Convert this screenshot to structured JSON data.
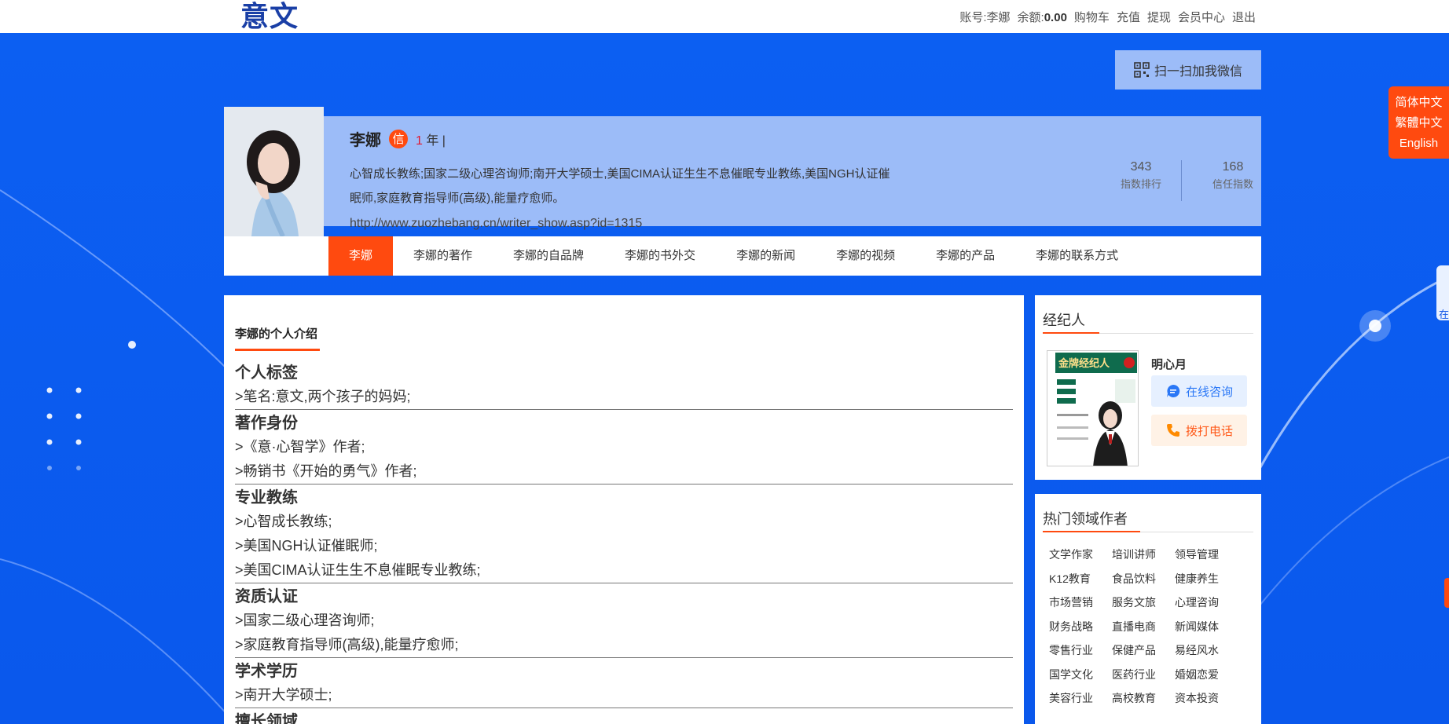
{
  "header": {
    "logo": "意文",
    "account_label": "账号:",
    "account_name": "李娜",
    "balance_label": "余额:",
    "balance_value": "0.00",
    "links": [
      "购物车",
      "充值",
      "提现",
      "会员中心",
      "退出"
    ]
  },
  "wechat_button": "扫一扫加我微信",
  "language": {
    "options": [
      "简体中文",
      "繁體中文",
      "English"
    ]
  },
  "side_tab_label": "在",
  "profile": {
    "name": "李娜",
    "badge": "信",
    "years_value": "1",
    "years_suffix": "年 |",
    "description": "心智成长教练;国家二级心理咨询师;南开大学硕士,美国CIMA认证生生不息催眠专业教练,美国NGH认证催眠师,家庭教育指导师(高级),能量疗愈师。",
    "url": "http://www.zuozhebang.cn/writer_show.asp?id=1315",
    "stats": [
      {
        "value": "343",
        "label": "指数排行"
      },
      {
        "value": "168",
        "label": "信任指数"
      }
    ]
  },
  "nav": {
    "items": [
      "李娜",
      "李娜的著作",
      "李娜的自品牌",
      "李娜的书外交",
      "李娜的新闻",
      "李娜的视频",
      "李娜的产品",
      "李娜的联系方式"
    ],
    "active_index": 0
  },
  "main": {
    "section_title": "李娜的个人介绍",
    "groups": [
      {
        "heading": "个人标签",
        "items": [
          ">笔名:意文,两个孩子的妈妈;"
        ]
      },
      {
        "heading": "著作身份",
        "items": [
          ">《意·心智学》作者;",
          ">畅销书《开始的勇气》作者;"
        ]
      },
      {
        "heading": "专业教练",
        "items": [
          ">心智成长教练;",
          ">美国NGH认证催眠师;",
          ">美国CIMA认证生生不息催眠专业教练;"
        ]
      },
      {
        "heading": "资质认证",
        "items": [
          ">国家二级心理咨询师;",
          ">家庭教育指导师(高级),能量疗愈师;"
        ]
      },
      {
        "heading": "学术学历",
        "items": [
          ">南开大学硕士;"
        ]
      },
      {
        "heading": "擅长领域",
        "items": []
      }
    ]
  },
  "agent_card": {
    "title": "经纪人",
    "agent_name": "明心月",
    "consult_button": "在线咨询",
    "call_button": "拨打电话",
    "book_title": "金牌经纪人"
  },
  "hot_card": {
    "title": "热门领域作者",
    "tags": [
      "文学作家",
      "培训讲师",
      "领导管理",
      "K12教育",
      "食品饮料",
      "健康养生",
      "市场营销",
      "服务文旅",
      "心理咨询",
      "财务战略",
      "直播电商",
      "新闻媒体",
      "零售行业",
      "保健产品",
      "易经风水",
      "国学文化",
      "医药行业",
      "婚姻恋爱",
      "美容行业",
      "高校教育",
      "资本投资"
    ]
  },
  "colors": {
    "accent": "#ff4a0f",
    "background_blue": "#0b5cf0",
    "profile_panel": "#9cbcf8",
    "logo": "#1a3fa6"
  }
}
